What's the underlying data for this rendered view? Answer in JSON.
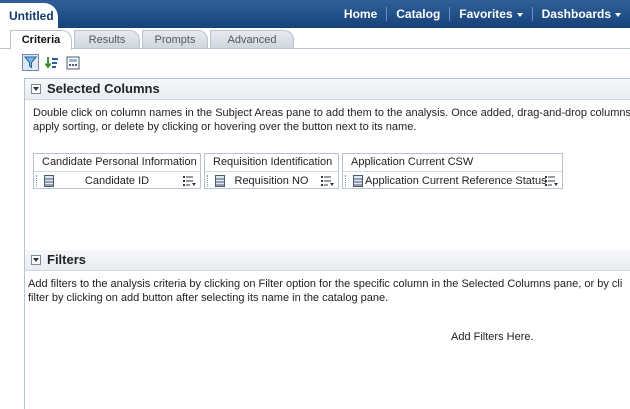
{
  "document_tab": "Untitled",
  "top_nav": {
    "home": "Home",
    "catalog": "Catalog",
    "favorites": "Favorites",
    "dashboards": "Dashboards"
  },
  "sub_tabs": [
    "Criteria",
    "Results",
    "Prompts",
    "Advanced"
  ],
  "active_tab": "Criteria",
  "toolbar_icons": [
    "filter-icon",
    "sort-icon",
    "calculator-icon"
  ],
  "selected_columns": {
    "title": "Selected Columns",
    "description_line1": "Double click on column names in the Subject Areas pane to add them to the analysis. Once added, drag-and-drop columns t",
    "description_line2": "apply sorting, or delete by clicking or hovering over the button next to its name.",
    "columns": [
      {
        "category": "Candidate Personal Information",
        "column": "Candidate ID"
      },
      {
        "category": "Requisition Identification",
        "column": "Requisition NO"
      },
      {
        "category": "Application Current CSW",
        "column": "Application Current Reference Status"
      }
    ]
  },
  "filters": {
    "title": "Filters",
    "description_line1": "Add filters to the analysis criteria by clicking on Filter option for the specific column in the Selected Columns pane, or by cli",
    "description_line2": "filter by clicking on add button after selecting its name in the catalog pane.",
    "empty_text": "Add Filters Here."
  },
  "colors": {
    "top_bar": "#17427a",
    "accent": "#2f5f99"
  }
}
